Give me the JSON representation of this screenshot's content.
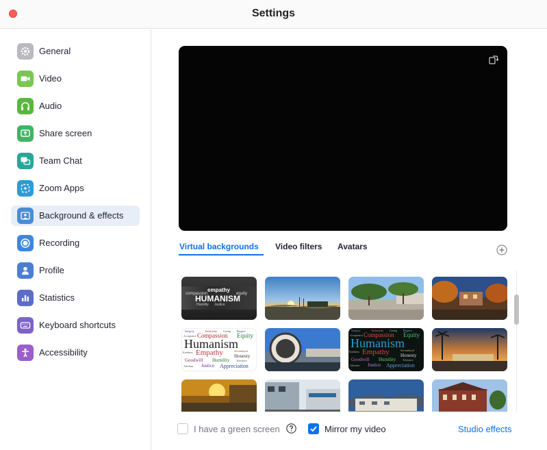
{
  "window": {
    "title": "Settings"
  },
  "sidebar": {
    "items": [
      {
        "label": "General",
        "icon": "gear-icon",
        "color": "#b9b9bf"
      },
      {
        "label": "Video",
        "icon": "video-camera-icon",
        "color": "#7bc651"
      },
      {
        "label": "Audio",
        "icon": "headphones-icon",
        "color": "#5ab73e"
      },
      {
        "label": "Share screen",
        "icon": "share-screen-icon",
        "color": "#43b363"
      },
      {
        "label": "Team Chat",
        "icon": "chat-bubbles-icon",
        "color": "#27a69a"
      },
      {
        "label": "Zoom Apps",
        "icon": "apps-icon",
        "color": "#2d9bd7"
      },
      {
        "label": "Background & effects",
        "icon": "background-person-icon",
        "color": "#4a8cd6"
      },
      {
        "label": "Recording",
        "icon": "record-circle-icon",
        "color": "#3d86e0"
      },
      {
        "label": "Profile",
        "icon": "user-icon",
        "color": "#4b7fd1"
      },
      {
        "label": "Statistics",
        "icon": "bar-chart-icon",
        "color": "#5c6dc9"
      },
      {
        "label": "Keyboard shortcuts",
        "icon": "keyboard-icon",
        "color": "#7e63c7"
      },
      {
        "label": "Accessibility",
        "icon": "accessibility-person-icon",
        "color": "#9c5ec8"
      }
    ],
    "active_index": 6
  },
  "preview": {
    "icon": "rotate-camera-icon"
  },
  "tabs": [
    {
      "label": "Virtual backgrounds",
      "active": true
    },
    {
      "label": "Video filters",
      "active": false
    },
    {
      "label": "Avatars",
      "active": false
    }
  ],
  "add_button": {
    "icon": "add-circle-icon"
  },
  "backgrounds": {
    "humanism_banner": {
      "top": "empathy",
      "left": "compassion",
      "right": "equity",
      "main": "HUMANISM",
      "sub_left": "Humility",
      "sub_right": "Justice"
    },
    "word_cloud": {
      "top_small": [
        "Integrity",
        "Inclusivity",
        "Caring",
        "Respect"
      ],
      "line1_left": "Acceptance",
      "line1_mid": "Compassion",
      "line1_right": "Equity",
      "main": "Humanism",
      "line3_left": "Kindness",
      "line3_mid": "Empathy",
      "line3_right": "Honesty",
      "line3_small": "Servanthood",
      "line4_left": "Goodwill",
      "line4_mid": "Humility",
      "line4_small": "Tolerance",
      "line5_left": "Altruism",
      "line5_mid": "Justice",
      "line5_right": "Appreciation"
    }
  },
  "footer": {
    "green_screen_label": "I have a green screen",
    "green_screen_checked": false,
    "help_icon": "help-circle-icon",
    "mirror_label": "Mirror my video",
    "mirror_checked": true,
    "studio_effects_label": "Studio effects"
  },
  "colors": {
    "accent": "#0e71eb",
    "close": "#fe5f57"
  }
}
